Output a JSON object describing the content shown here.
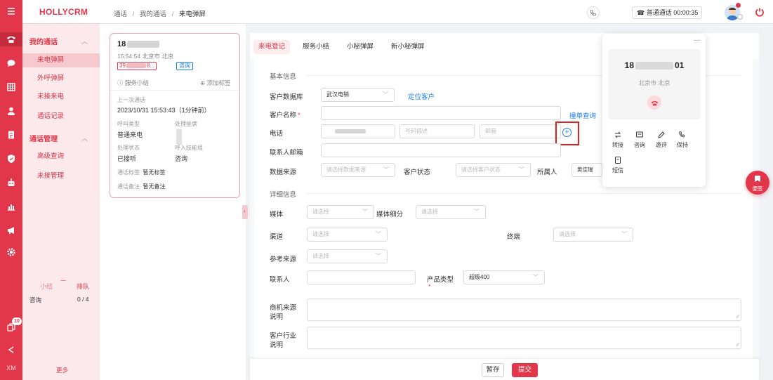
{
  "brand": "HOLLYCRM",
  "rail": {
    "menu_icon": "menu-icon",
    "items": [
      "phone-icon",
      "chat-icon",
      "grid-icon",
      "user-icon",
      "document-icon",
      "shield-icon",
      "robot-icon",
      "chart-icon",
      "megaphone-icon",
      "gear-icon"
    ],
    "badge": "10",
    "bottom_label": "XM"
  },
  "nav": {
    "group1": "我的通话",
    "group1_items": [
      "来电弹屏",
      "外呼弹屏",
      "未接来电",
      "通话记录"
    ],
    "group2": "通话管理",
    "group2_items": [
      "高级查询",
      "未接管理"
    ],
    "queue": {
      "tab1": "小结",
      "tab2": "排队",
      "row_label": "咨询",
      "row_count": "0 / 4"
    },
    "more": "更多"
  },
  "topbar": {
    "breadcrumb": [
      "通话",
      "我的通话",
      "来电弹屏"
    ],
    "call_status": "普通通话 00:00:35"
  },
  "card": {
    "phone_prefix": "18",
    "time_location": "15:54:54 北京市 北京",
    "tag_prefix": "39",
    "tag_suffix": "8...",
    "consult_tag": "咨询",
    "service_summary": "服务小结",
    "add_tag": "添加标签",
    "last_call_label": "上一次通话",
    "last_call_time": "2023/10/31 15:53:43（1分钟前）",
    "call_type_label": "呼叫类型",
    "call_type": "普通来电",
    "handler_label": "处理坐席",
    "status_label": "处理状态",
    "status": "已接听",
    "skill_group_label": "呼入技能组",
    "skill_group": "咨询",
    "call_tag_label": "通话标签",
    "call_tag": "暂无标签",
    "call_note_label": "通话备注",
    "call_note": "暂无备注"
  },
  "tabs": [
    "来电登记",
    "服务小结",
    "小秘弹屏",
    "新小秘弹屏"
  ],
  "form": {
    "basic_title": "基本信息",
    "db_label": "客户数据库",
    "db_value": "武汉电销",
    "locate": "定位客户",
    "name_label": "客户名称",
    "required": "*",
    "dup_check": "撞单查询",
    "phone_label": "电话",
    "phone_desc_ph": "号码描述",
    "email_ph": "邮箱",
    "contact_email_label": "联系人邮箱",
    "source_label": "数据来源",
    "source_ph": "请选择数据来源",
    "cust_status_label": "客户状态",
    "cust_status_ph": "请选择客户状态",
    "owner_label": "所属人",
    "owner_value": "黄佳瑞",
    "detail_title": "详细信息",
    "media_label": "媒体",
    "media_sub_label": "媒体细分",
    "channel_label": "渠道",
    "terminal_label": "终端",
    "ref_source_label": "参考来源",
    "contact_label": "联系人",
    "product_type_label": "产品类型",
    "product_type_value": "超级400",
    "select_ph": "请选择",
    "opp_source_label": "商机来源说明",
    "industry_label": "客户行业说明"
  },
  "float": {
    "phone_prefix": "18",
    "phone_suffix": "01",
    "location": "北京市 北京",
    "actions": [
      "转接",
      "咨询",
      "邀评",
      "保持",
      "短信"
    ]
  },
  "sticky": "便签",
  "bottom": {
    "save": "暂存",
    "submit": "提交"
  },
  "colors": {
    "brand": "#e2374a",
    "link": "#1e7ef0",
    "highlight_box": "#e0201f"
  }
}
